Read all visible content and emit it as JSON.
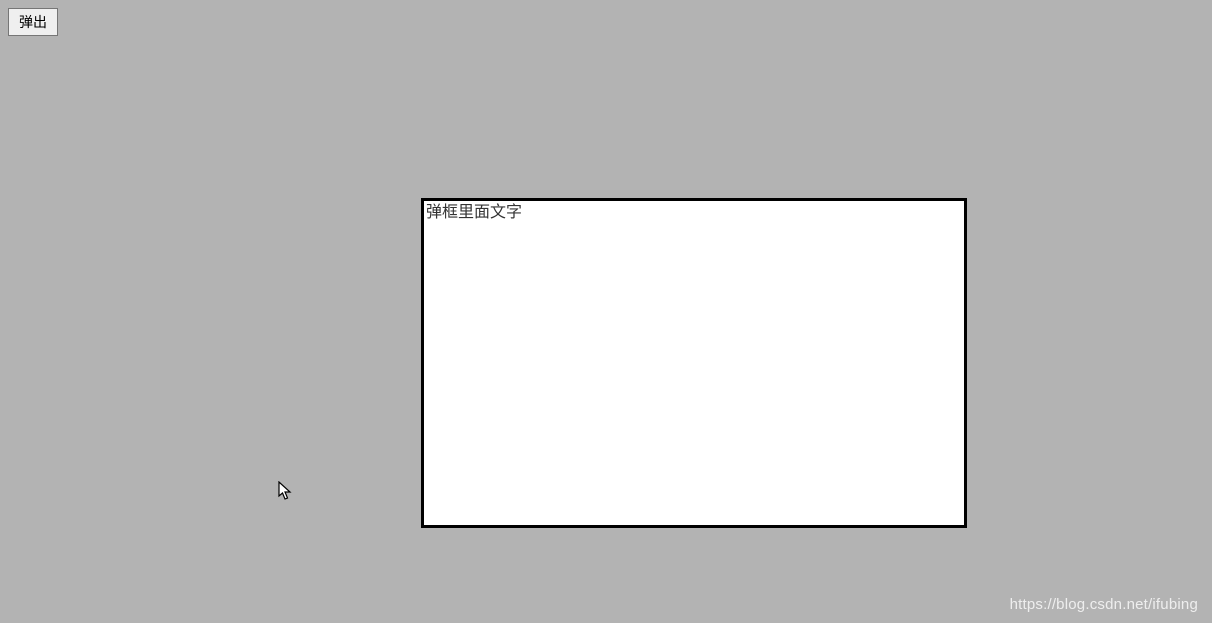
{
  "button": {
    "popup_label": "弹出"
  },
  "modal": {
    "content_text": "弹框里面文字"
  },
  "watermark": {
    "text": "https://blog.csdn.net/ifubing"
  }
}
